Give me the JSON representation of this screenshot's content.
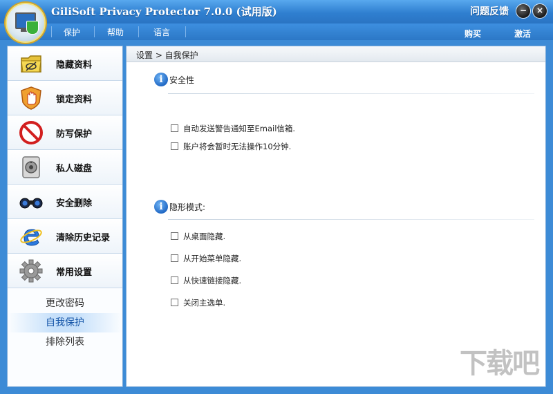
{
  "window": {
    "title": "GiliSoft Privacy Protector 7.0.0 (试用版)",
    "feedback": "问题反馈",
    "minimize": "−",
    "close": "×"
  },
  "menu": {
    "items": [
      "保护",
      "帮助",
      "语言"
    ],
    "buy": "购买",
    "activate": "激活"
  },
  "sidebar": {
    "items": [
      {
        "label": "隐藏资料",
        "icon": "hide-folder-icon"
      },
      {
        "label": "锁定资料",
        "icon": "stop-hand-icon"
      },
      {
        "label": "防写保护",
        "icon": "no-entry-icon"
      },
      {
        "label": "私人磁盘",
        "icon": "safe-disk-icon"
      },
      {
        "label": "安全删除",
        "icon": "binoculars-icon"
      },
      {
        "label": "清除历史记录",
        "icon": "ie-browser-icon"
      },
      {
        "label": "常用设置",
        "icon": "gear-icon"
      }
    ],
    "sub_items": [
      "更改密码",
      "自我保护",
      "排除列表"
    ],
    "active_sub": "自我保护"
  },
  "content": {
    "breadcrumb": "设置 > 自我保护",
    "sections": [
      {
        "title": "安全性",
        "options": [
          {
            "label": "自动发送警告通知至Email信箱.",
            "checked": false
          },
          {
            "label": "账户将会暂时无法操作10分钟.",
            "checked": false
          }
        ]
      },
      {
        "title": "隐形模式:",
        "options": [
          {
            "label": "从桌面隐藏.",
            "checked": false
          },
          {
            "label": "从开始菜单隐藏.",
            "checked": false
          },
          {
            "label": "从快速链接隐藏.",
            "checked": false
          },
          {
            "label": "关闭主选单.",
            "checked": false
          }
        ]
      }
    ]
  },
  "watermark": "下载吧",
  "colors": {
    "titlebar": "#2f7fd0",
    "frame": "#3d8bd6",
    "accent": "#1c64c2",
    "active_sub_bg": "#c6e0fa"
  }
}
